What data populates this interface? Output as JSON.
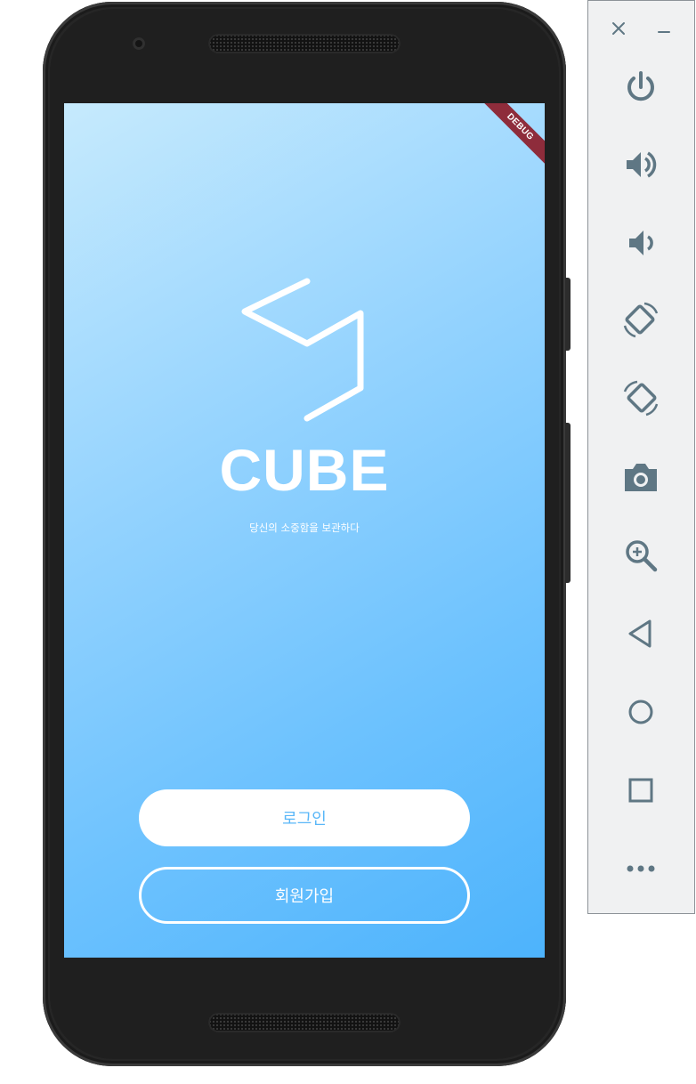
{
  "app": {
    "debug_banner": "DEBUG",
    "brand_name": "CUBE",
    "tagline": "당신의 소중함을 보관하다",
    "login_button": "로그인",
    "signup_button": "회원가입"
  },
  "emulator_panel": {
    "window_controls": [
      {
        "name": "close-icon"
      },
      {
        "name": "minimize-icon"
      }
    ],
    "tools": [
      {
        "name": "power-icon"
      },
      {
        "name": "volume-up-icon"
      },
      {
        "name": "volume-down-icon"
      },
      {
        "name": "rotate-left-icon"
      },
      {
        "name": "rotate-right-icon"
      },
      {
        "name": "camera-icon"
      },
      {
        "name": "zoom-in-icon"
      },
      {
        "name": "back-icon"
      },
      {
        "name": "home-icon"
      },
      {
        "name": "overview-icon"
      },
      {
        "name": "more-icon"
      }
    ]
  },
  "colors": {
    "screen_gradient_start": "#c6eafd",
    "screen_gradient_end": "#4db3fc",
    "login_text": "#5ab7f8",
    "debug_ribbon": "#8e2c3b",
    "panel_icon": "#5f7784",
    "phone_body": "#262626"
  }
}
